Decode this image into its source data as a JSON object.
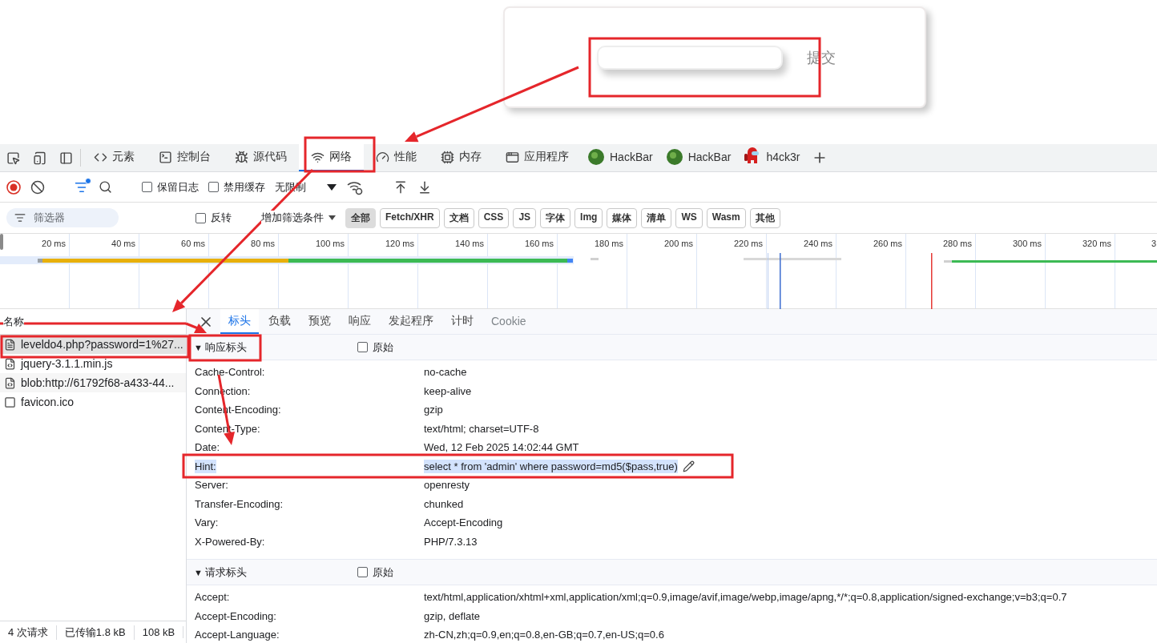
{
  "page": {
    "submit": "提交"
  },
  "devtools": {
    "tools": [
      {
        "kind": "inspect"
      },
      {
        "kind": "device"
      },
      {
        "kind": "dock"
      }
    ],
    "tabs": [
      {
        "kind": "code",
        "label": "元素",
        "selected": false
      },
      {
        "kind": "terminal",
        "label": "控制台",
        "selected": false
      },
      {
        "kind": "bug",
        "label": "源代码",
        "selected": false
      },
      {
        "kind": "wifi",
        "label": "网络",
        "selected": true
      },
      {
        "kind": "gauge",
        "label": "性能",
        "selected": false
      },
      {
        "kind": "chip",
        "label": "内存",
        "selected": false
      },
      {
        "kind": "window",
        "label": "应用程序",
        "selected": false
      },
      {
        "kind": "ball",
        "label": "HackBar",
        "selected": false
      },
      {
        "kind": "ball",
        "label": "HackBar",
        "selected": false
      },
      {
        "kind": "figure",
        "label": "h4ck3r",
        "selected": false
      }
    ],
    "toolbar": {
      "recording": true,
      "filter_active": true,
      "options": [
        {
          "label": "保留日志",
          "checked": false
        },
        {
          "label": "禁用缓存",
          "checked": false
        }
      ],
      "throttle": "无限制"
    },
    "filter_bar": {
      "placeholder": "筛选器",
      "invert": {
        "label": "反转",
        "checked": false
      },
      "more_filters": "增加筛选条件",
      "types": [
        {
          "label": "全部",
          "selected": true
        },
        {
          "label": "Fetch/XHR",
          "selected": false
        },
        {
          "label": "文档",
          "selected": false
        },
        {
          "label": "CSS",
          "selected": false
        },
        {
          "label": "JS",
          "selected": false
        },
        {
          "label": "字体",
          "selected": false
        },
        {
          "label": "Img",
          "selected": false
        },
        {
          "label": "媒体",
          "selected": false
        },
        {
          "label": "清单",
          "selected": false
        },
        {
          "label": "WS",
          "selected": false
        },
        {
          "label": "Wasm",
          "selected": false
        },
        {
          "label": "其他",
          "selected": false
        }
      ]
    },
    "timeline": {
      "ticks": [
        "20 ms",
        "40 ms",
        "60 ms",
        "80 ms",
        "100 ms",
        "120 ms",
        "140 ms",
        "160 ms",
        "180 ms",
        "200 ms",
        "220 ms",
        "240 ms",
        "260 ms",
        "280 ms",
        "300 ms",
        "320 ms",
        "3"
      ]
    },
    "requests": {
      "header": "名称",
      "items": [
        {
          "name": "leveldo4.php?password=1%27...",
          "kind": "document",
          "selected": true
        },
        {
          "name": "jquery-3.1.1.min.js",
          "kind": "script",
          "selected": false
        },
        {
          "name": "blob:http://61792f68-a433-44...",
          "kind": "script",
          "selected": false
        },
        {
          "name": "favicon.ico",
          "kind": "other",
          "selected": false
        }
      ],
      "summary": [
        "4 次请求",
        "已传输1.8 kB",
        "108 kB"
      ]
    },
    "detail": {
      "tabs": [
        {
          "label": "标头",
          "selected": true,
          "disabled": false
        },
        {
          "label": "负载",
          "selected": false,
          "disabled": false
        },
        {
          "label": "预览",
          "selected": false,
          "disabled": false
        },
        {
          "label": "响应",
          "selected": false,
          "disabled": false
        },
        {
          "label": "发起程序",
          "selected": false,
          "disabled": false
        },
        {
          "label": "计时",
          "selected": false,
          "disabled": false
        },
        {
          "label": "Cookie",
          "selected": false,
          "disabled": true
        }
      ],
      "sections": [
        {
          "toggle": "▼",
          "title": "响应标头",
          "expanded": true,
          "raw": {
            "label": "原始",
            "checked": false
          },
          "rows": [
            {
              "name": "Cache-Control:",
              "value": "no-cache",
              "selected": false
            },
            {
              "name": "Connection:",
              "value": "keep-alive",
              "selected": false
            },
            {
              "name": "Content-Encoding:",
              "value": "gzip",
              "selected": false
            },
            {
              "name": "Content-Type:",
              "value": "text/html; charset=UTF-8",
              "selected": false
            },
            {
              "name": "Date:",
              "value": "Wed, 12 Feb 2025 14:02:44 GMT",
              "selected": false
            },
            {
              "name": "Hint:",
              "value": "select * from 'admin' where password=md5($pass,true)",
              "selected": true
            },
            {
              "name": "Server:",
              "value": "openresty",
              "selected": false
            },
            {
              "name": "Transfer-Encoding:",
              "value": "chunked",
              "selected": false
            },
            {
              "name": "Vary:",
              "value": "Accept-Encoding",
              "selected": false
            },
            {
              "name": "X-Powered-By:",
              "value": "PHP/7.3.13",
              "selected": false
            }
          ]
        },
        {
          "toggle": "▼",
          "title": "请求标头",
          "expanded": true,
          "raw": {
            "label": "原始",
            "checked": false
          },
          "rows": [
            {
              "name": "Accept:",
              "value": "text/html,application/xhtml+xml,application/xml;q=0.9,image/avif,image/webp,image/apng,*/*;q=0.8,application/signed-exchange;v=b3;q=0.7",
              "selected": false
            },
            {
              "name": "Accept-Encoding:",
              "value": "gzip, deflate",
              "selected": false
            },
            {
              "name": "Accept-Language:",
              "value": "zh-CN,zh;q=0.9,en;q=0.8,en-GB;q=0.7,en-US;q=0.6",
              "selected": false
            }
          ]
        }
      ]
    }
  }
}
